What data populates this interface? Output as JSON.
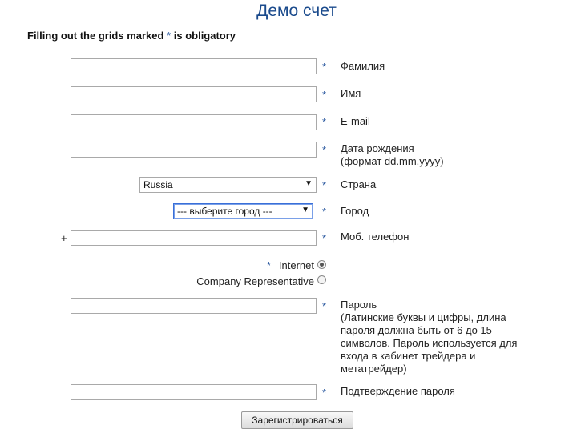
{
  "header": {
    "title": "Демо счет"
  },
  "notice": {
    "text_before": "Filling out the grids marked ",
    "star": "*",
    "text_after": " is obligatory"
  },
  "required_mark": "*",
  "form": {
    "surname": {
      "label": "Фамилия",
      "value": ""
    },
    "name": {
      "label": "Имя",
      "value": ""
    },
    "email": {
      "label": "E-mail",
      "value": ""
    },
    "birthdate": {
      "label_line1": "Дата рождения",
      "label_line2": "(формат dd.mm.yyyy)",
      "value": ""
    },
    "country": {
      "label": "Страна",
      "selected": "Russia"
    },
    "city": {
      "label": "Город",
      "selected": "--- выберите город ---"
    },
    "phone": {
      "label": "Моб. телефон",
      "prefix": "+",
      "value": ""
    },
    "account_type": {
      "options": [
        {
          "label": "Internet",
          "checked": true
        },
        {
          "label": "Company Representative",
          "checked": false
        }
      ]
    },
    "password": {
      "label_lines": [
        "Пароль",
        "(Латинские буквы и цифры, длина",
        "пароля должна быть от 6 до 15",
        "символов. Пароль используется для",
        "входа в кабинет трейдера и",
        "метатрейдер)"
      ],
      "value": ""
    },
    "password_confirm": {
      "label": "Подтверждение пароля",
      "value": ""
    },
    "submit_label": "Зарегистрироваться"
  }
}
